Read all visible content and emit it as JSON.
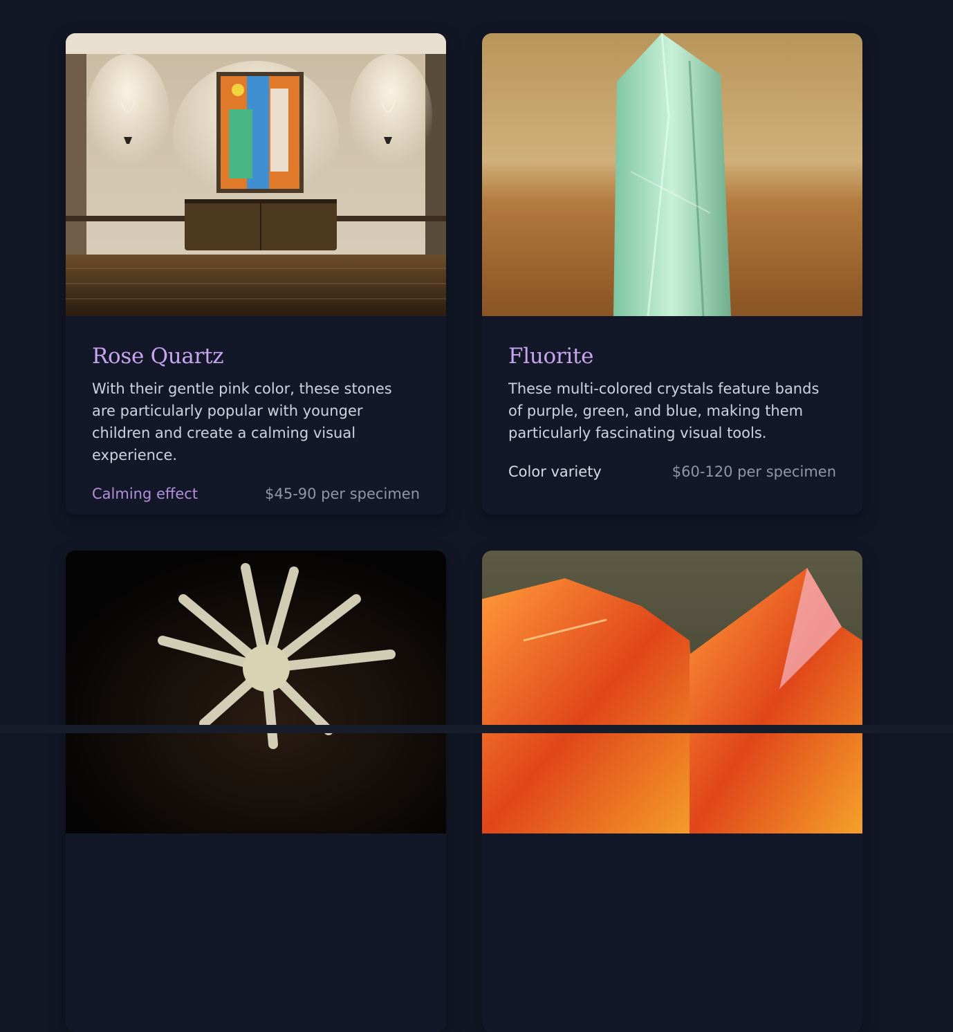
{
  "cards": [
    {
      "title": "Rose Quartz",
      "description": "With their gentle pink color, these stones are particularly popular with younger children and create a calming visual experience.",
      "tag": "Calming effect",
      "price": "$45-90 per specimen",
      "image": "gallery-room-photo",
      "tag_color": "#b48fdc"
    },
    {
      "title": "Fluorite",
      "description": "These multi-colored crystals feature bands of purple, green, and blue, making them particularly fascinating visual tools.",
      "tag": "Color variety",
      "price": "$60-120 per specimen",
      "image": "green-crystal-photo",
      "tag_color": "#d7dbe4"
    },
    {
      "image": "white-crystal-cluster-photo"
    },
    {
      "image": "orange-crystal-photo"
    }
  ],
  "colors": {
    "background": "#121726",
    "card": "#131828",
    "title": "#c7a5ef",
    "body_text": "#cfd3de",
    "price": "#8f97a8"
  }
}
